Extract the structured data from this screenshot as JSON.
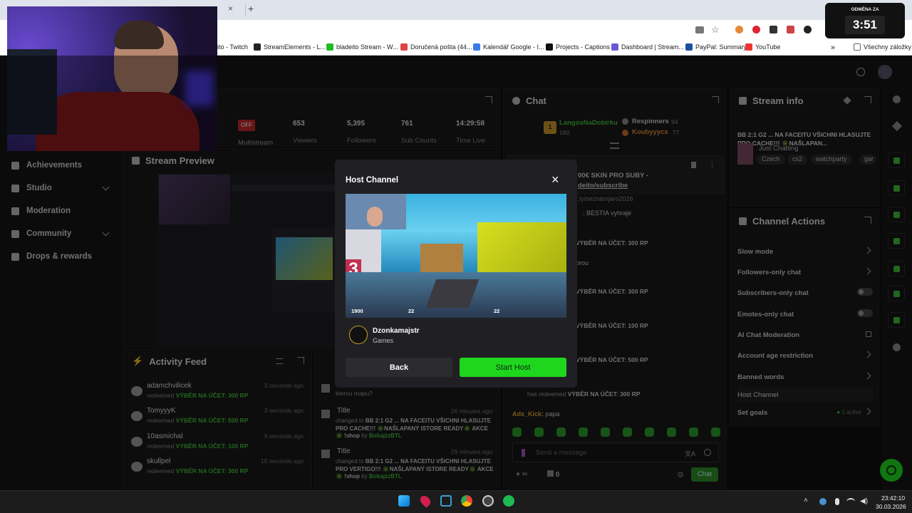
{
  "browser": {
    "tabs": [
      {
        "close": "×"
      },
      {
        "close": "×"
      }
    ],
    "new_tab": "+",
    "bookmarks": [
      {
        "label": "eito - Twitch"
      },
      {
        "label": "StreamElements - L..."
      },
      {
        "label": "bladeito Stream - W..."
      },
      {
        "label": "Doručená pošta (44..."
      },
      {
        "label": "Kalendář Google - I..."
      },
      {
        "label": "Projects - Captions"
      },
      {
        "label": "Dashboard | Stream..."
      },
      {
        "label": "PayPal: Summary"
      },
      {
        "label": "YouTube"
      }
    ],
    "bookmarks_more": "»",
    "all_bookmarks": "Všechny záložky"
  },
  "timer": {
    "label": "ODMĚNA ZA",
    "value": "3:51"
  },
  "sidebar": {
    "items": [
      {
        "label": "Achievements"
      },
      {
        "label": "Studio"
      },
      {
        "label": "Moderation"
      },
      {
        "label": "Community"
      },
      {
        "label": "Drops & rewards"
      }
    ]
  },
  "stats": {
    "offline_badge": "OFF",
    "multistream": "Multistream",
    "items": [
      {
        "value": "653",
        "label": "Viewers"
      },
      {
        "value": "5,395",
        "label": "Followers"
      },
      {
        "value": "761",
        "label": "Sub Counts"
      },
      {
        "value": "14:29:58",
        "label": "Time Live"
      }
    ]
  },
  "stream_preview": {
    "title": "Stream Preview"
  },
  "activity": {
    "title": "Activity Feed",
    "rows": [
      {
        "name": "adamchvilicek",
        "action": "redeemed",
        "reward": "VÝBĚR NA ÚČET: 300 RP",
        "time": "3 seconds ago"
      },
      {
        "name": "TomyyyK",
        "action": "redeemed",
        "reward": "VÝBĚR NA ÚČET: 500 RP",
        "time": "3 seconds ago"
      },
      {
        "name": "10asmichal",
        "action": "redeemed",
        "reward": "VÝBĚR NA ÚČET: 100 RP",
        "time": "9 seconds ago"
      },
      {
        "name": "skullpel",
        "action": "redeemed",
        "reward": "VÝBĚR NA ÚČET: 300 RP",
        "time": "10 seconds ago"
      }
    ]
  },
  "history": {
    "rows": [
      {
        "title": "",
        "body": "kterou mapu?",
        "time": ""
      },
      {
        "title": "Title",
        "changed": "changed to",
        "body": "BB 2:1 G2 ... NA FACEITU VŠICHNI HLASUJTE PRO CACHE!!! ✳️NAŠLAPANÝ ISTORE READY✳️ AKCE ✳️ !shop",
        "by": "by",
        "user": "BobajzzBTL",
        "time": "26 minutes ago"
      },
      {
        "title": "Title",
        "changed": "changed to",
        "body": "BB 2:1 G2 ... NA FACEITU VŠICHNI HLASUJTE PRO VERTIGO!!! ✳️NAŠLAPANÝ ISTORE READY✳️ AKCE ✳️ !shop",
        "by": "by",
        "user": "BobajzzBTL",
        "time": "29 minutes ago"
      }
    ]
  },
  "chat": {
    "title": "Chat",
    "leaders": [
      {
        "rank": "1",
        "name": "LangosNaDobirku",
        "score": "160"
      },
      {
        "name": "Respinners",
        "score": "94"
      },
      {
        "name": "Koubyyycs",
        "score": "77"
      }
    ],
    "pinned": {
      "line1": "00€ SKIN PRO SUBY -",
      "line2": "deito/subscribe"
    },
    "messages": [
      {
        "text": "t.ly/seznamjaro2026"
      },
      {
        "text": ": BESTIA vyhraje"
      },
      {
        "text": "VÝBĚR NA ÚČET: 300 RP"
      },
      {
        "text": "orou"
      },
      {
        "text": "VÝBĚR NA ÚČET: 300 RP"
      },
      {
        "text": "VÝBĚR NA ÚČET: 100 RP"
      },
      {
        "text": "VÝBĚR NA ÚČET: 500 RP"
      },
      {
        "prefix": "has redeemed",
        "text": "VÝBĚR NA ÚČET: 300 RP"
      }
    ],
    "last": {
      "user": "Adx_Kick:",
      "text": "papa"
    },
    "input_placeholder": "Send a message",
    "viewers_sym": "∞",
    "count": "0",
    "send": "Chat"
  },
  "stream_info": {
    "title": "Stream info",
    "stream_title": "BB 2:1 G2 ... NA FACEITU VŠICHNI HLASUJTE PRO CACHE!!! ✳️NAŠLAPAN...",
    "category": "Just Chatting",
    "tags": [
      "Czech",
      "cs2",
      "watchparty",
      "gar"
    ]
  },
  "channel_actions": {
    "title": "Channel Actions",
    "items": [
      {
        "label": "Slow mode",
        "kind": "chevron"
      },
      {
        "label": "Followers-only chat",
        "kind": "chevron"
      },
      {
        "label": "Subscribers-only chat",
        "kind": "toggle"
      },
      {
        "label": "Emotes-only chat",
        "kind": "toggle"
      },
      {
        "label": "AI Chat Moderation",
        "kind": "external"
      },
      {
        "label": "Account age restriction",
        "kind": "chevron"
      },
      {
        "label": "Banned words",
        "kind": "chevron"
      },
      {
        "label": "Host Channel",
        "kind": "none"
      },
      {
        "label": "Set goals",
        "kind": "chevron",
        "status": "1 active"
      }
    ]
  },
  "modal": {
    "title": "Host Channel",
    "close": "×",
    "channel": "Dzonkamajstr",
    "category": "Games",
    "hud_left": "1900",
    "hud_mid": "22",
    "hud_right": "22",
    "back": "Back",
    "start": "Start Host"
  },
  "taskbar": {
    "time": "23:42:10",
    "date": "30.03.2026"
  },
  "colors": {
    "accent": "#1fd61f",
    "brand_green": "#3fbb3a",
    "bg": "#0f0f10",
    "panel": "#181818"
  }
}
